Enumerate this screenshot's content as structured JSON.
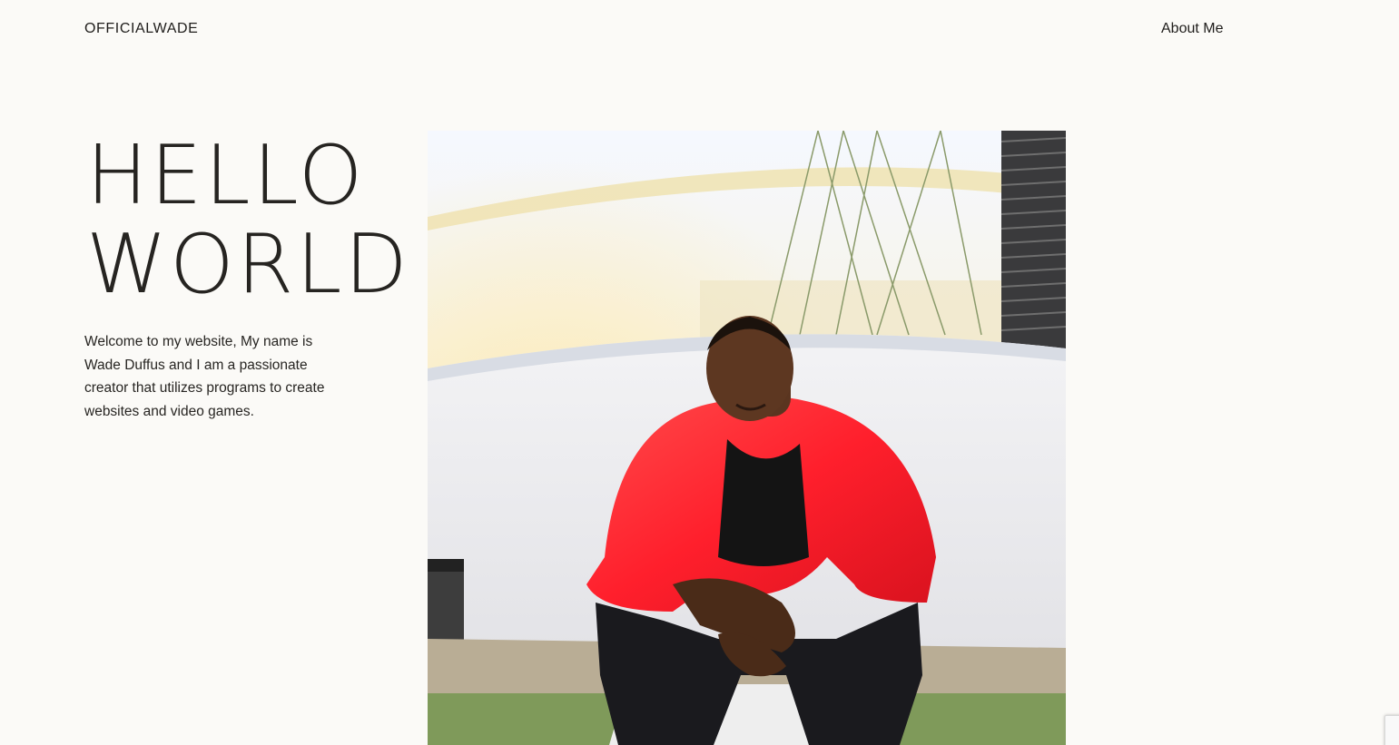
{
  "header": {
    "brand": "OFFICIALWADE",
    "nav_about": "About Me"
  },
  "hero": {
    "title_line1": "HELLO",
    "title_line2": "WORLD",
    "intro": "Welcome to my website, My name is Wade Duffus and I am a passionate creator that utilizes programs to create websites and video games."
  },
  "colors": {
    "background": "#fbfaf7",
    "text": "#23211f",
    "jacket": "#ff2d2d"
  },
  "icons": {
    "recaptcha": "recaptcha-badge-icon"
  }
}
